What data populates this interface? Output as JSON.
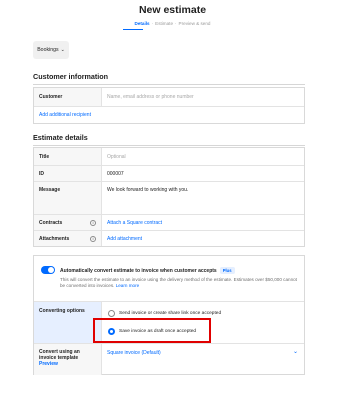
{
  "header": {
    "title": "New estimate",
    "steps": [
      "Details",
      "Estimate",
      "Preview & send"
    ],
    "active_step": "Details"
  },
  "bookings_button": "Bookings",
  "customer": {
    "section_title": "Customer information",
    "customer_label": "Customer",
    "customer_placeholder": "Name, email address or phone number",
    "add_recipient": "Add additional recipient"
  },
  "estimate": {
    "section_title": "Estimate details",
    "title_label": "Title",
    "title_placeholder": "Optional",
    "id_label": "ID",
    "id_value": "000007",
    "message_label": "Message",
    "message_value": "We look forward to working with you.",
    "contracts_label": "Contracts",
    "contracts_link": "Attach a Square contract",
    "attachments_label": "Attachments",
    "attachments_link": "Add attachment"
  },
  "conversion": {
    "toggle_on": true,
    "toggle_title": "Automatically convert estimate to invoice when customer accepts",
    "plus_badge": "Plus",
    "description": "This will convert the estimate to an invoice using the delivery method of the estimate. Estimates over $50,000 cannot be converted into invoices.",
    "learn_more": "Learn more",
    "options_label": "Converting options",
    "option_send": "Send invoice or create share link once accepted",
    "option_draft": "Save invoice as draft once accepted",
    "selected_option": "draft",
    "template_label_line1": "Convert using an",
    "template_label_line2": "invoice template",
    "preview_link": "Preview",
    "template_value": "Square invoice (Default)"
  },
  "colors": {
    "accent": "#006aff",
    "highlight": "#e00000"
  }
}
